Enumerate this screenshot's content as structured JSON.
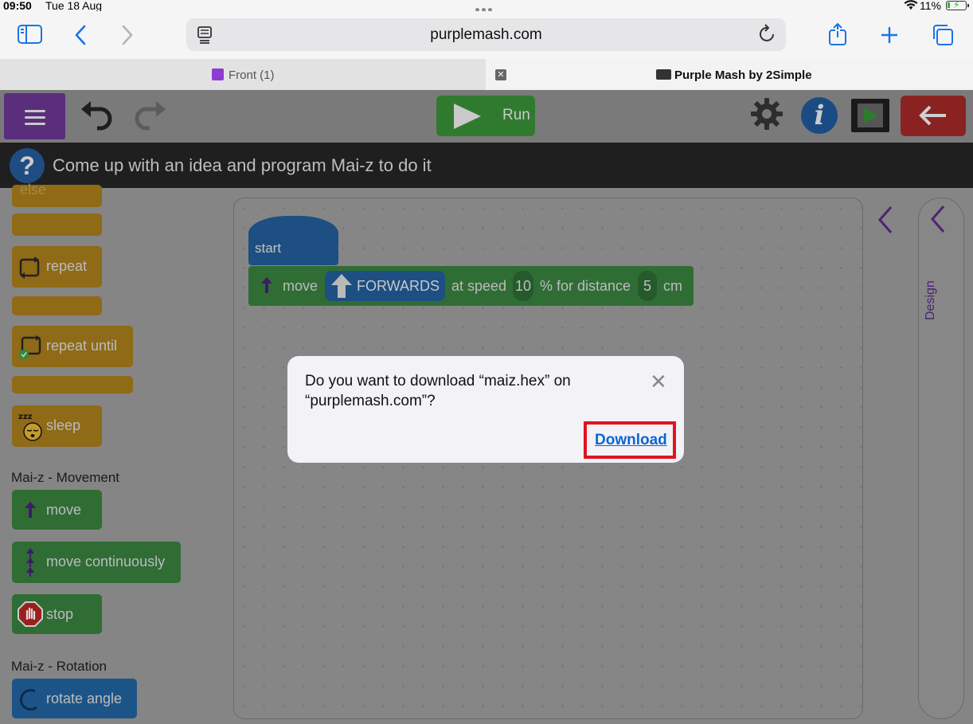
{
  "status_bar": {
    "time": "09:50",
    "date": "Tue 18 Aug",
    "battery": "11%"
  },
  "browser": {
    "url": "purplemash.com",
    "tabs": [
      {
        "label": "Front (1)"
      },
      {
        "label": "Purple Mash by 2Simple"
      }
    ]
  },
  "app": {
    "run_label": "Run",
    "instruction": "Come up with an idea and program Mai-z to do it"
  },
  "palette": {
    "blocks_control": [
      "else",
      "repeat",
      "repeat until",
      "sleep"
    ],
    "section_movement": "Mai-z - Movement",
    "blocks_movement": [
      "move",
      "move continuously",
      "stop"
    ],
    "section_rotation": "Mai-z - Rotation",
    "blocks_rotation": [
      "rotate angle"
    ]
  },
  "script": {
    "start_label": "start",
    "move_label": "move",
    "direction": "FORWARDS",
    "at_speed": "at speed",
    "speed": "10",
    "for_distance": "% for distance",
    "distance": "5",
    "unit": "cm"
  },
  "side_panel": {
    "label": "Design"
  },
  "dialog": {
    "message": "Do you want to download “maiz.hex” on “purplemash.com”?",
    "download_label": "Download"
  }
}
